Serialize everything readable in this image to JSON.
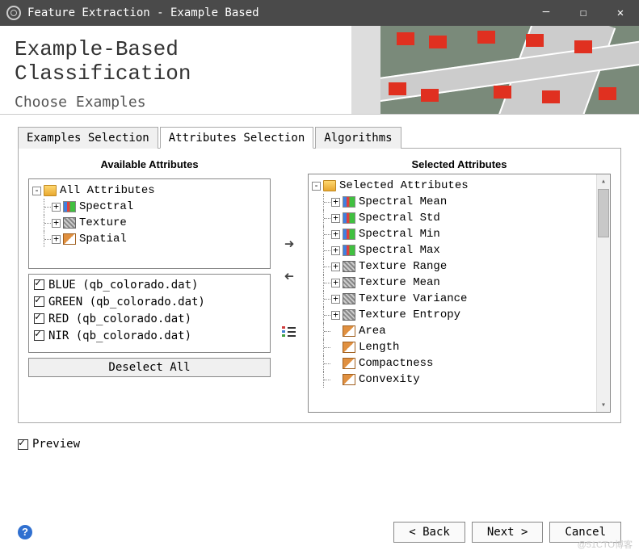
{
  "window": {
    "title": "Feature Extraction - Example Based"
  },
  "header": {
    "title": "Example-Based Classification",
    "subtitle": "Choose Examples"
  },
  "tabs": [
    {
      "label": "Examples Selection",
      "active": false
    },
    {
      "label": "Attributes Selection",
      "active": true
    },
    {
      "label": "Algorithms",
      "active": false
    }
  ],
  "leftPanel": {
    "title": "Available Attributes",
    "root": "All Attributes",
    "children": [
      {
        "label": "Spectral",
        "icon": "spectral"
      },
      {
        "label": "Texture",
        "icon": "texture"
      },
      {
        "label": "Spatial",
        "icon": "spatial"
      }
    ]
  },
  "bands": [
    {
      "label": "BLUE (qb_colorado.dat)",
      "checked": true
    },
    {
      "label": "GREEN (qb_colorado.dat)",
      "checked": true
    },
    {
      "label": "RED (qb_colorado.dat)",
      "checked": true
    },
    {
      "label": "NIR (qb_colorado.dat)",
      "checked": true
    }
  ],
  "deselectLabel": "Deselect All",
  "rightPanel": {
    "title": "Selected Attributes",
    "root": "Selected Attributes",
    "children": [
      {
        "label": "Spectral Mean",
        "icon": "spectral",
        "expandable": true
      },
      {
        "label": "Spectral Std",
        "icon": "spectral",
        "expandable": true
      },
      {
        "label": "Spectral Min",
        "icon": "spectral",
        "expandable": true
      },
      {
        "label": "Spectral Max",
        "icon": "spectral",
        "expandable": true
      },
      {
        "label": "Texture Range",
        "icon": "texture",
        "expandable": true
      },
      {
        "label": "Texture Mean",
        "icon": "texture",
        "expandable": true
      },
      {
        "label": "Texture Variance",
        "icon": "texture",
        "expandable": true
      },
      {
        "label": "Texture Entropy",
        "icon": "texture",
        "expandable": true
      },
      {
        "label": "Area",
        "icon": "spatial",
        "expandable": false
      },
      {
        "label": "Length",
        "icon": "spatial",
        "expandable": false
      },
      {
        "label": "Compactness",
        "icon": "spatial",
        "expandable": false
      },
      {
        "label": "Convexity",
        "icon": "spatial",
        "expandable": false
      }
    ]
  },
  "previewLabel": "Preview",
  "previewChecked": true,
  "footer": {
    "back": "< Back",
    "next": "Next >",
    "cancel": "Cancel"
  },
  "watermark": "@51CTO博客"
}
